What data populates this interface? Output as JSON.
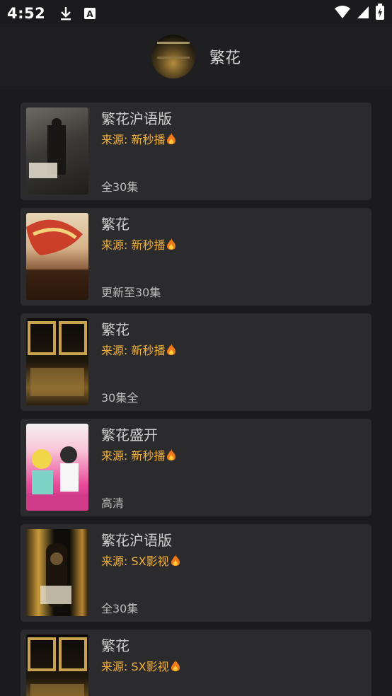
{
  "status": {
    "time": "4:52",
    "icons": [
      "download-icon",
      "keyboard-a-icon",
      "wifi-icon",
      "signal-icon",
      "battery-icon"
    ]
  },
  "header": {
    "title": "繁花",
    "avatar": "avatar-icon"
  },
  "results": [
    {
      "title": "繁花沪语版",
      "source": "来源: 新秒播",
      "episodes": "全30集",
      "poster_colors": [
        "#3b3a36",
        "#b8b2a2"
      ]
    },
    {
      "title": "繁花",
      "source": "来源: 新秒播",
      "episodes": "更新至30集",
      "poster_colors": [
        "#c23b26",
        "#e4c9a0"
      ]
    },
    {
      "title": "繁花",
      "source": "来源: 新秒播",
      "episodes": "30集全",
      "poster_colors": [
        "#0d0b07",
        "#b58d44"
      ]
    },
    {
      "title": "繁花盛开",
      "source": "来源: 新秒播",
      "episodes": "高清",
      "poster_colors": [
        "#e94a9a",
        "#f8c6d8"
      ]
    },
    {
      "title": "繁花沪语版",
      "source": "来源: SX影视",
      "episodes": "全30集",
      "poster_colors": [
        "#0f0d0a",
        "#c89a3a"
      ]
    },
    {
      "title": "繁花",
      "source": "来源: SX影视",
      "episodes": "",
      "poster_colors": [
        "#0d0b07",
        "#b58d44"
      ]
    }
  ],
  "colors": {
    "background": "#1b1b1d",
    "card": "#2b2b2d",
    "source_accent": "#f4b23a"
  }
}
